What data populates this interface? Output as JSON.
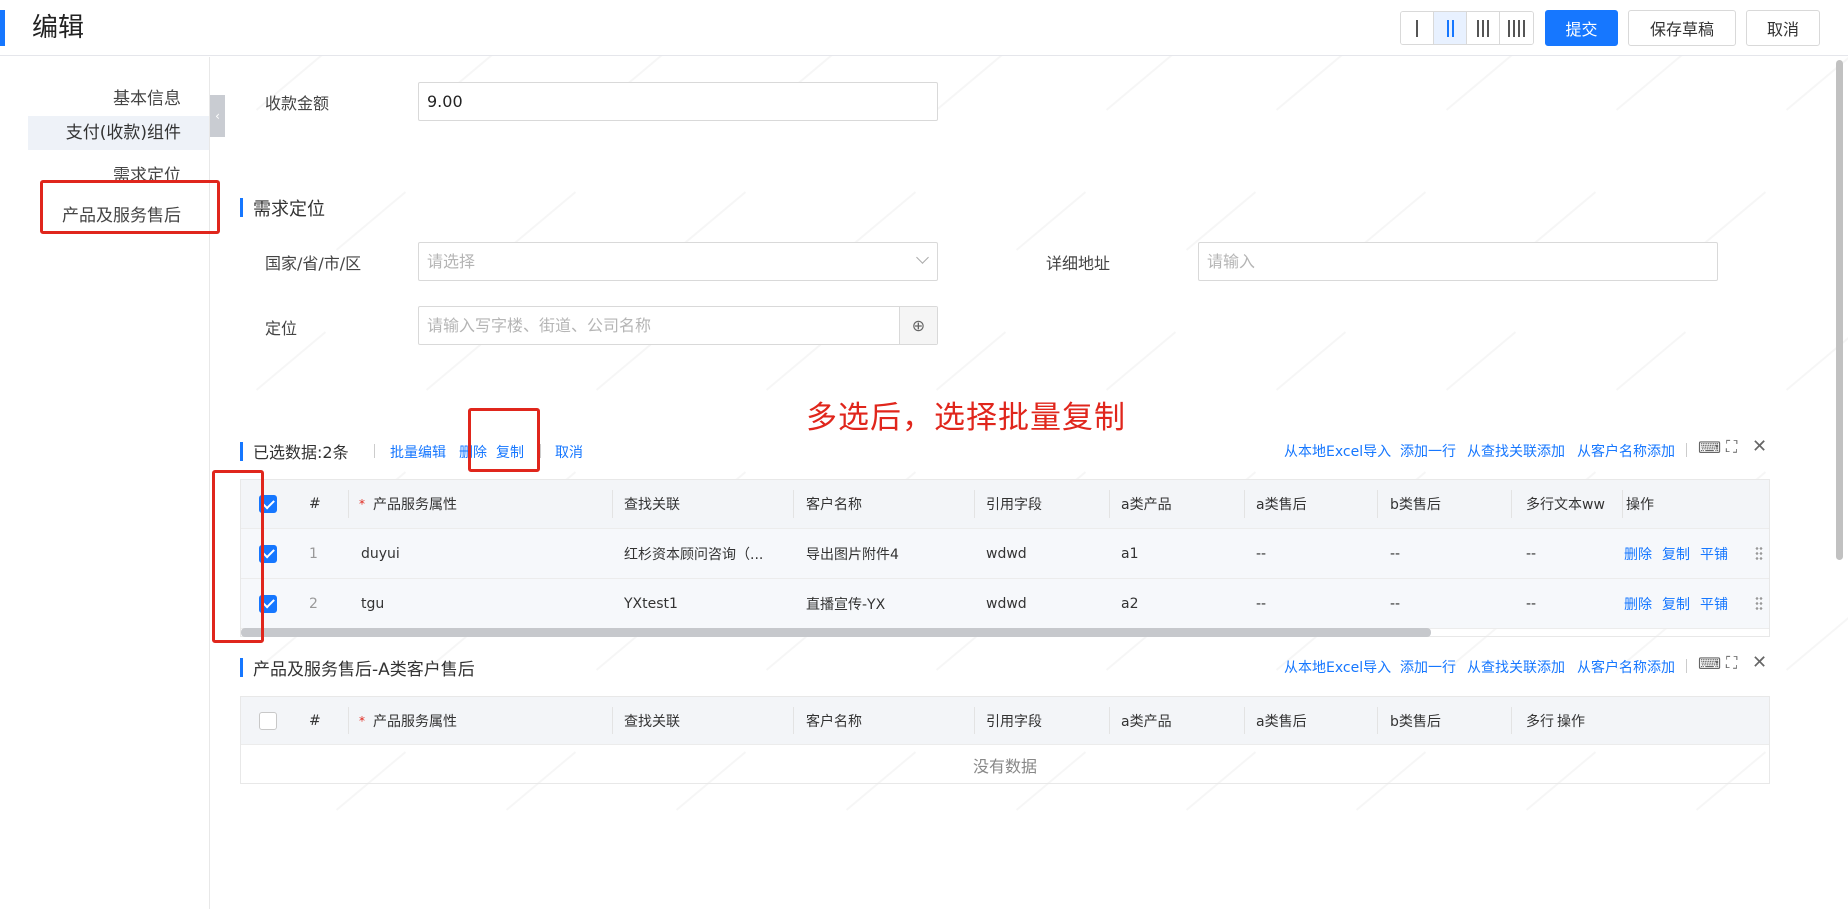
{
  "header": {
    "title": "编辑",
    "submit": "提交",
    "save_draft": "保存草稿",
    "cancel": "取消",
    "column_options": [
      "1-column-icon",
      "2-column-icon",
      "3-column-icon",
      "4-column-icon"
    ],
    "active_column": "2-column-icon"
  },
  "sidebar": {
    "items": [
      {
        "label": "基本信息"
      },
      {
        "label": "支付(收款)组件",
        "active": true
      },
      {
        "label": "需求定位"
      },
      {
        "label": "产品及服务售后"
      }
    ]
  },
  "payment": {
    "amount_label": "收款金额",
    "amount_value": "9.00"
  },
  "demand": {
    "title": "需求定位",
    "region_label": "国家/省/市/区",
    "region_placeholder": "请选择",
    "address_label": "详细地址",
    "address_placeholder": "请输入",
    "location_label": "定位",
    "location_placeholder": "请输入写字楼、街道、公司名称"
  },
  "annotation": {
    "text": "多选后，选择批量复制"
  },
  "table1": {
    "selected_text": "已选数据:2条",
    "batch_edit": "批量编辑",
    "delete": "删除",
    "copy": "复制",
    "cancel": "取消",
    "actions": [
      "从本地Excel导入",
      "添加一行",
      "从查找关联添加",
      "从客户名称添加"
    ],
    "columns": [
      "#",
      "产品服务属性",
      "查找关联",
      "客户名称",
      "引用字段",
      "a类产品",
      "a类售后",
      "b类售后",
      "多行文本ww",
      "操作"
    ],
    "rows": [
      {
        "num": "1",
        "attr": "duyui",
        "lookup": "红杉资本顾问咨询（...",
        "customer": "导出图片附件4",
        "ref": "wdwd",
        "a_prod": "a1",
        "a_after": "--",
        "b_after": "--",
        "multi": "--"
      },
      {
        "num": "2",
        "attr": "tgu",
        "lookup": "YXtest1",
        "customer": "直播宣传-YX",
        "ref": "wdwd",
        "a_prod": "a2",
        "a_after": "--",
        "b_after": "--",
        "multi": "--"
      }
    ],
    "row_ops": [
      "删除",
      "复制",
      "平铺"
    ]
  },
  "table2": {
    "title": "产品及服务售后-A类客户售后",
    "actions": [
      "从本地Excel导入",
      "添加一行",
      "从查找关联添加",
      "从客户名称添加"
    ],
    "columns": [
      "#",
      "产品服务属性",
      "查找关联",
      "客户名称",
      "引用字段",
      "a类产品",
      "a类售后",
      "b类售后",
      "多行",
      "操作"
    ],
    "empty_text": "没有数据"
  },
  "colors": {
    "primary": "#1677ff",
    "annotation_red": "#e0261c"
  }
}
